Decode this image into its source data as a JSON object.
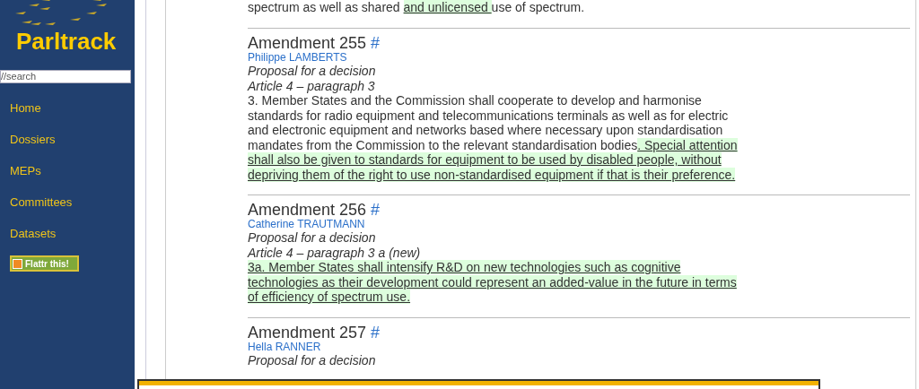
{
  "sidebar": {
    "logo": "Parltrack",
    "search": {
      "placeholder": "//search"
    },
    "items": [
      "Home",
      "Dossiers",
      "MEPs",
      "Committees",
      "Datasets"
    ],
    "flattr_button": "Flattr this!"
  },
  "top_text": [
    {
      "text": "spectrum as well as shared ",
      "inserted": false
    },
    {
      "text": "and unlicensed ",
      "inserted": true
    },
    {
      "text": "use of spectrum.",
      "inserted": false
    }
  ],
  "amendments": [
    {
      "title": "Amendment 255",
      "anchor": "#",
      "author": "Philippe LAMBERTS",
      "lines": [
        "Proposal for a decision",
        "Article 4 – paragraph 3"
      ],
      "text": [
        {
          "text": "3. Member States and the Commission shall cooperate to develop and harmonise standards for radio equipment and telecommunications terminals as well as for electric and electronic equipment and networks based where necessary upon standardisation mandates from the Commission to the relevant standardisation bodies",
          "inserted": false
        },
        {
          "text": ". Special attention shall also be given to standards for equipment to be used by disabled people, without depriving them of the right to use non-standardised equipment if that is their preference.",
          "inserted": true
        }
      ]
    },
    {
      "title": "Amendment 256",
      "anchor": "#",
      "author": "Catherine TRAUTMANN",
      "lines": [
        "Proposal for a decision",
        "Article 4 – paragraph 3 a (new)"
      ],
      "text": [
        {
          "text": "3a. Member States shall intensify R&D on new technologies such as cognitive technologies as their development could represent an added-value in the future in terms of efficiency of spectrum use.",
          "inserted": true
        }
      ]
    },
    {
      "title": "Amendment 257",
      "anchor": "#",
      "author": "Hella RANNER",
      "lines": [
        "Proposal for a decision"
      ]
    }
  ]
}
